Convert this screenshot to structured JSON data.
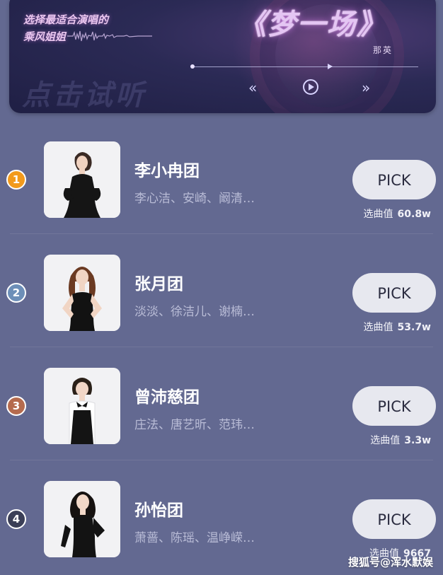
{
  "banner": {
    "tagline_line1": "选择最适合演唱的",
    "tagline_line2": "乘风姐姐",
    "song_title": "《梦一场》",
    "artist": "那英",
    "listen_label": "点击试听",
    "controls": [
      "rewind-icon",
      "play-icon",
      "fast-forward-icon"
    ]
  },
  "accent_colors": {
    "rank_1": "#f29a1c",
    "rank_2": "#6d8fb8",
    "rank_3": "#b56b4e",
    "rank_4": "#3b3f57",
    "background": "#636991",
    "pick_button": "#e7e8ef"
  },
  "teams": [
    {
      "rank": "1",
      "name": "李小冉团",
      "members": "李心洁、安崎、阚清…",
      "pick_label": "PICK",
      "score_label": "选曲值",
      "score_value": "60.8w"
    },
    {
      "rank": "2",
      "name": "张月团",
      "members": "淡淡、徐洁儿、谢楠…",
      "pick_label": "PICK",
      "score_label": "选曲值",
      "score_value": "53.7w"
    },
    {
      "rank": "3",
      "name": "曾沛慈团",
      "members": "庄法、唐艺昕、范玮…",
      "pick_label": "PICK",
      "score_label": "选曲值",
      "score_value": "3.3w"
    },
    {
      "rank": "4",
      "name": "孙怡团",
      "members": "萧蔷、陈瑶、温峥嵘…",
      "pick_label": "PICK",
      "score_label": "选曲值",
      "score_value": "9667"
    }
  ],
  "watermark": "搜狐号@浑水默娱"
}
